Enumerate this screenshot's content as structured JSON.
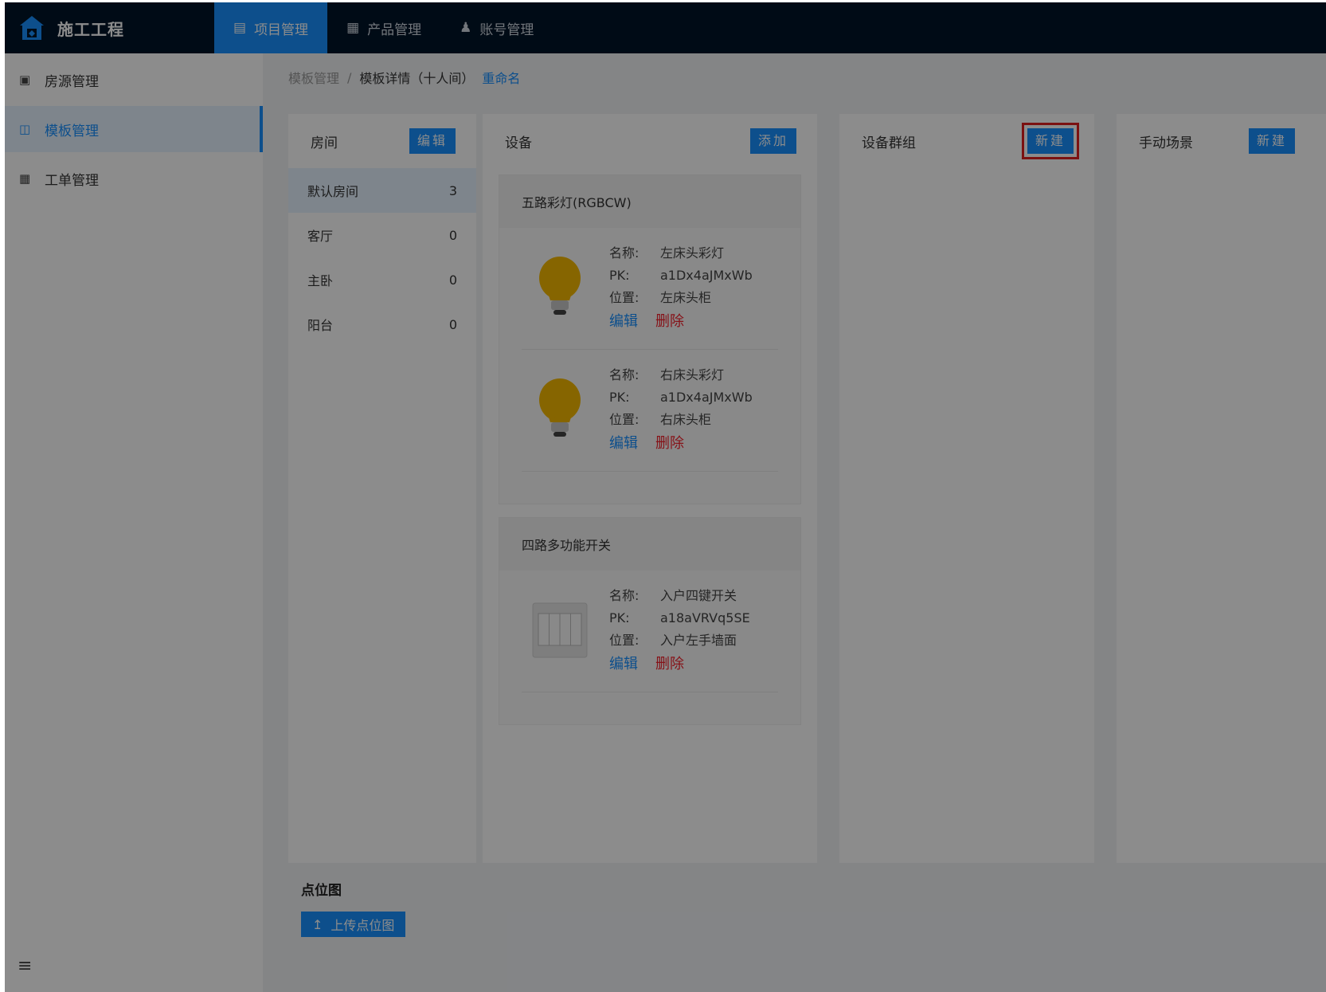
{
  "app": {
    "title": "施工工程"
  },
  "nav": [
    {
      "label": "项目管理",
      "icon": "document-icon",
      "active": true
    },
    {
      "label": "产品管理",
      "icon": "grid-icon",
      "active": false
    },
    {
      "label": "账号管理",
      "icon": "user-icon",
      "active": false
    }
  ],
  "sidebar": {
    "items": [
      {
        "label": "房源管理",
        "icon": "house-icon",
        "active": false
      },
      {
        "label": "模板管理",
        "icon": "template-icon",
        "active": true
      },
      {
        "label": "工单管理",
        "icon": "order-icon",
        "active": false
      }
    ]
  },
  "breadcrumb": {
    "parent": "模板管理",
    "separator": "/",
    "current": "模板详情（十人间）",
    "action": "重命名"
  },
  "rooms": {
    "title": "房间",
    "button": "编辑",
    "items": [
      {
        "name": "默认房间",
        "count": "3",
        "active": true
      },
      {
        "name": "客厅",
        "count": "0",
        "active": false
      },
      {
        "name": "主卧",
        "count": "0",
        "active": false
      },
      {
        "name": "阳台",
        "count": "0",
        "active": false
      }
    ]
  },
  "devices": {
    "title": "设备",
    "button": "添加",
    "groups": [
      {
        "type": "五路彩灯(RGBCW)",
        "items": [
          {
            "name_label": "名称:",
            "name": "左床头彩灯",
            "pk_label": "PK:",
            "pk": "a1Dx4aJMxWb",
            "loc_label": "位置:",
            "location": "左床头柜",
            "edit": "编辑",
            "delete": "删除",
            "icon": "light-bulb-icon"
          },
          {
            "name_label": "名称:",
            "name": "右床头彩灯",
            "pk_label": "PK:",
            "pk": "a1Dx4aJMxWb",
            "loc_label": "位置:",
            "location": "右床头柜",
            "edit": "编辑",
            "delete": "删除",
            "icon": "light-bulb-icon"
          }
        ]
      },
      {
        "type": "四路多功能开关",
        "items": [
          {
            "name_label": "名称:",
            "name": "入户四键开关",
            "pk_label": "PK:",
            "pk": "a18aVRVq5SE",
            "loc_label": "位置:",
            "location": "入户左手墙面",
            "edit": "编辑",
            "delete": "删除",
            "icon": "wall-switch-icon"
          }
        ]
      }
    ]
  },
  "device_groups": {
    "title": "设备群组",
    "button": "新建"
  },
  "scenes": {
    "title": "手动场景",
    "button": "新建"
  },
  "pointmap": {
    "title": "点位图",
    "button": "上传点位图"
  },
  "colors": {
    "primary": "#1890ff",
    "header": "#001529",
    "danger": "#f5222d",
    "highlight": "#e02020"
  }
}
